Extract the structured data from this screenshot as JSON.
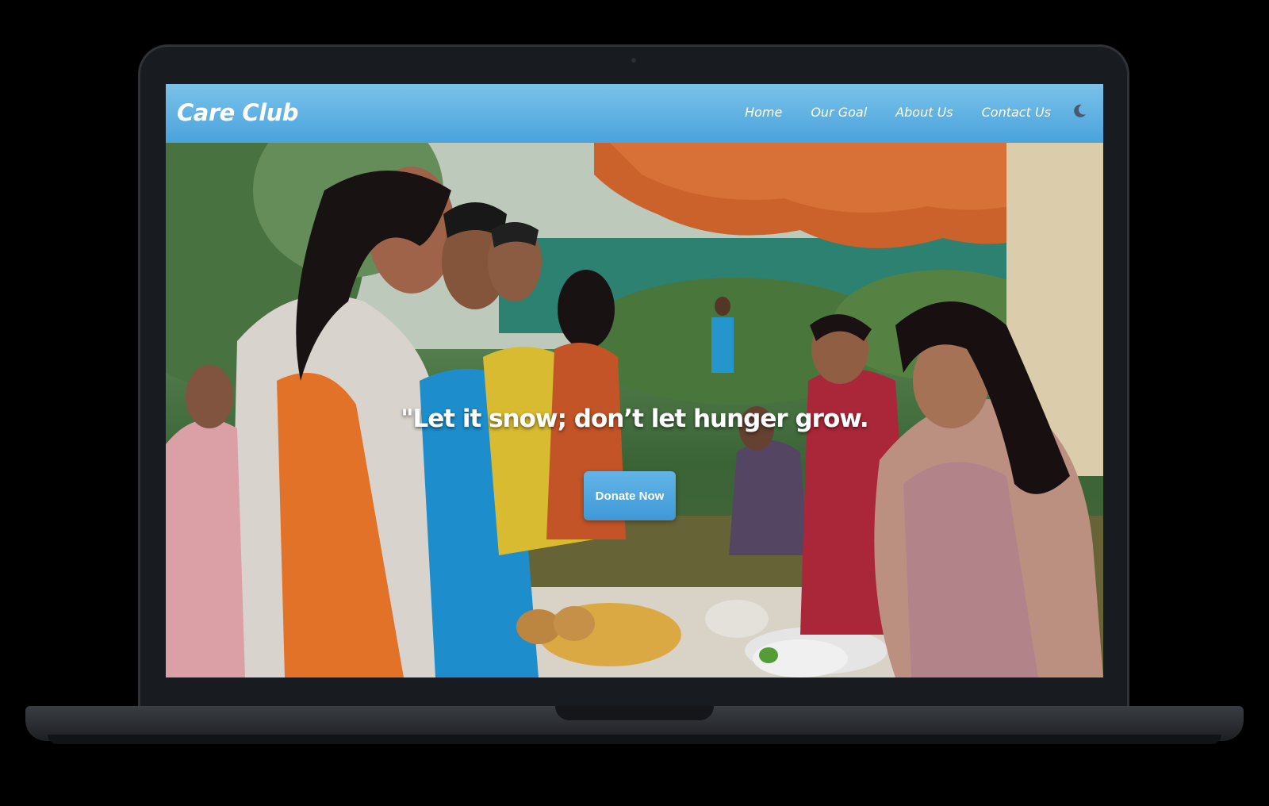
{
  "site": {
    "brand": "Care Club"
  },
  "nav": {
    "items": [
      {
        "label": "Home"
      },
      {
        "label": "Our Goal"
      },
      {
        "label": "About Us"
      },
      {
        "label": "Contact Us"
      }
    ],
    "theme_toggle_icon": "moon-icon"
  },
  "hero": {
    "quote": "\"Let it snow; don’t let hunger grow.",
    "cta_label": "Donate Now"
  },
  "colors": {
    "navbar_top": "#79c2ea",
    "navbar_bottom": "#4aa3dc",
    "cta": "#4aa6e0",
    "bezel": "#181c21"
  }
}
